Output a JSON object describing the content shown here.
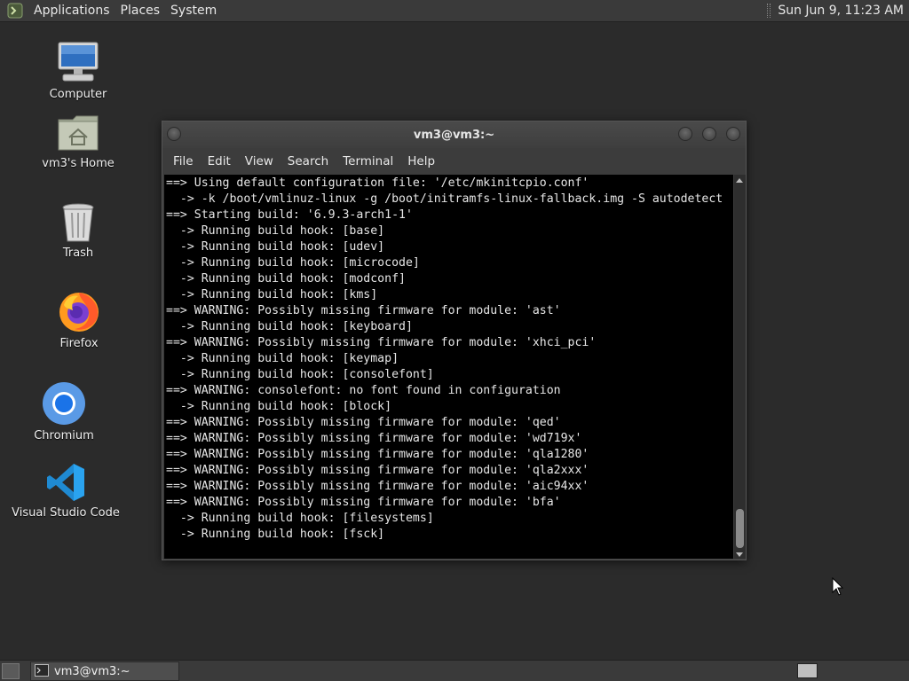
{
  "top_panel": {
    "menus": [
      "Applications",
      "Places",
      "System"
    ],
    "clock": "Sun Jun  9, 11:23 AM"
  },
  "desktop": {
    "icons": [
      {
        "label": "Computer",
        "icon": "computer-icon"
      },
      {
        "label": "vm3's Home",
        "icon": "home-folder-icon"
      },
      {
        "label": "Trash",
        "icon": "trash-icon"
      },
      {
        "label": "Firefox",
        "icon": "firefox-icon"
      },
      {
        "label": "Chromium",
        "icon": "chromium-icon"
      },
      {
        "label": "Visual Studio Code",
        "icon": "vscode-icon"
      }
    ]
  },
  "terminal": {
    "title": "vm3@vm3:~",
    "menus": [
      "File",
      "Edit",
      "View",
      "Search",
      "Terminal",
      "Help"
    ],
    "lines": [
      "==> Using default configuration file: '/etc/mkinitcpio.conf'",
      "  -> -k /boot/vmlinuz-linux -g /boot/initramfs-linux-fallback.img -S autodetect",
      "==> Starting build: '6.9.3-arch1-1'",
      "  -> Running build hook: [base]",
      "  -> Running build hook: [udev]",
      "  -> Running build hook: [microcode]",
      "  -> Running build hook: [modconf]",
      "  -> Running build hook: [kms]",
      "==> WARNING: Possibly missing firmware for module: 'ast'",
      "  -> Running build hook: [keyboard]",
      "==> WARNING: Possibly missing firmware for module: 'xhci_pci'",
      "  -> Running build hook: [keymap]",
      "  -> Running build hook: [consolefont]",
      "==> WARNING: consolefont: no font found in configuration",
      "  -> Running build hook: [block]",
      "==> WARNING: Possibly missing firmware for module: 'qed'",
      "==> WARNING: Possibly missing firmware for module: 'wd719x'",
      "==> WARNING: Possibly missing firmware for module: 'qla1280'",
      "==> WARNING: Possibly missing firmware for module: 'qla2xxx'",
      "==> WARNING: Possibly missing firmware for module: 'aic94xx'",
      "==> WARNING: Possibly missing firmware for module: 'bfa'",
      "  -> Running build hook: [filesystems]",
      "  -> Running build hook: [fsck]"
    ]
  },
  "taskbar": {
    "window_button": "vm3@vm3:~"
  },
  "colors": {
    "desktop_bg": "#2b2b2b",
    "panel_bg": "#3a3a3a",
    "terminal_bg": "#000000",
    "terminal_fg": "#e6e6e6"
  }
}
